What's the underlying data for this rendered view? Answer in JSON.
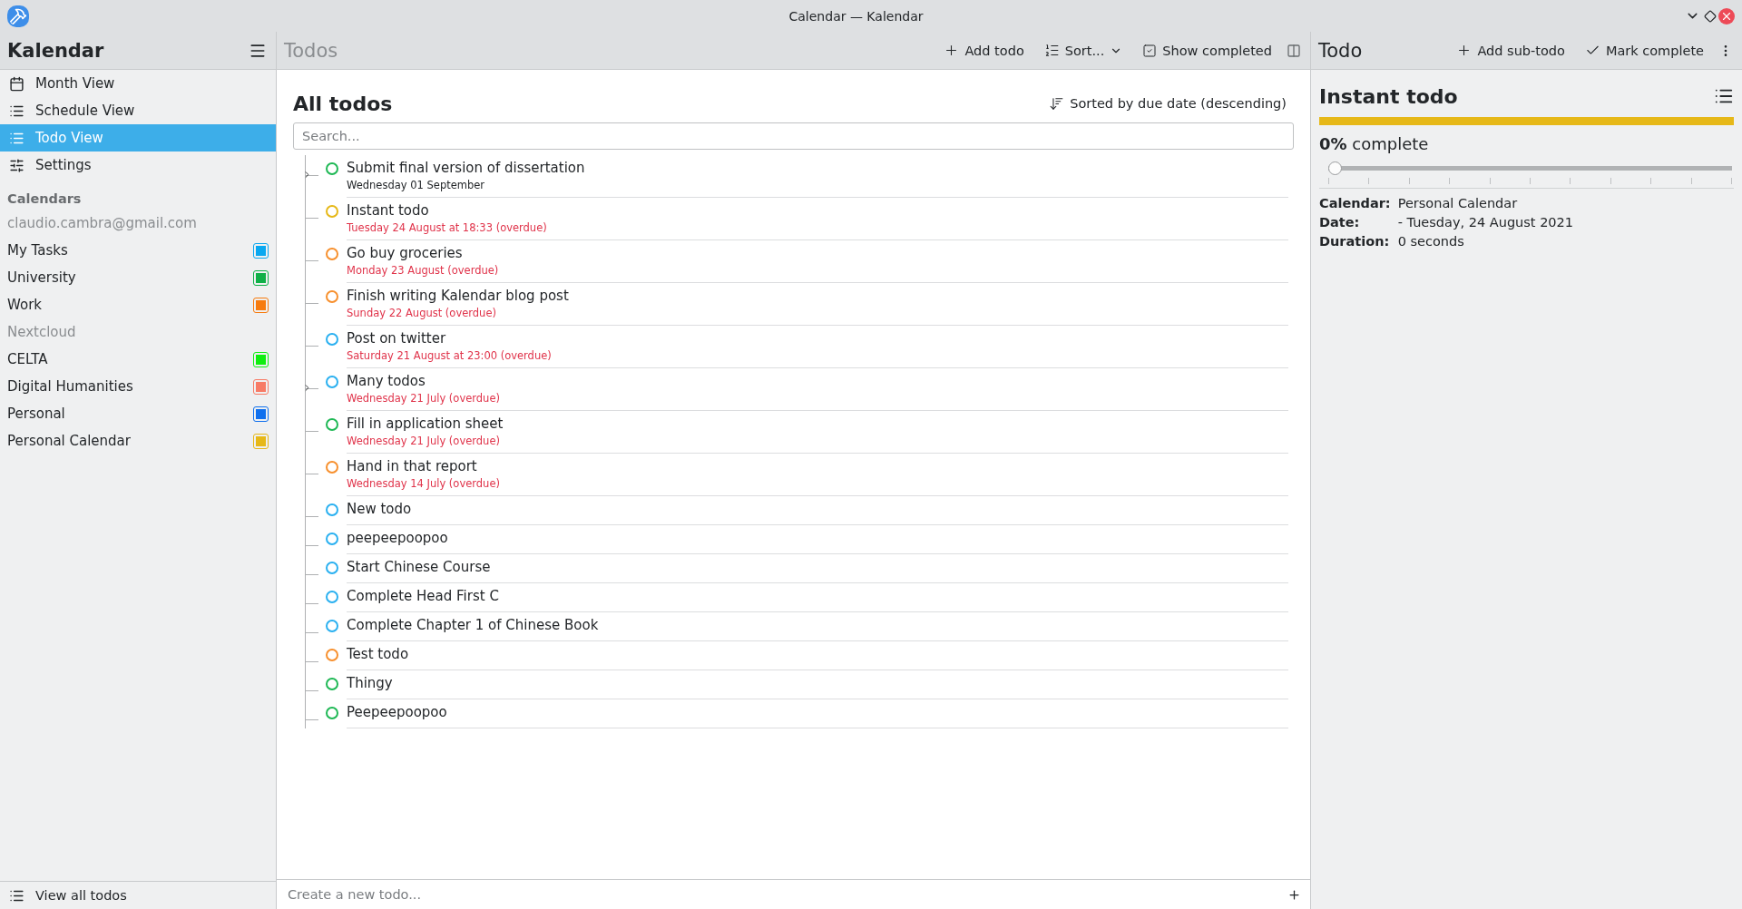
{
  "window": {
    "title": "Calendar — Kalendar"
  },
  "sidebar": {
    "title": "Kalendar",
    "nav": [
      {
        "label": "Month View",
        "selected": false
      },
      {
        "label": "Schedule View",
        "selected": false
      },
      {
        "label": "Todo View",
        "selected": true
      },
      {
        "label": "Settings",
        "selected": false
      }
    ],
    "calendars_heading": "Calendars",
    "calendars": [
      {
        "kind": "account",
        "label": "claudio.cambra@gmail.com"
      },
      {
        "kind": "calendar",
        "label": "My Tasks",
        "color": "#0aa8f0"
      },
      {
        "kind": "calendar",
        "label": "University",
        "color": "#10b048"
      },
      {
        "kind": "calendar",
        "label": "Work",
        "color": "#f77b0e"
      },
      {
        "kind": "account",
        "label": "Nextcloud"
      },
      {
        "kind": "calendar",
        "label": "CELTA",
        "color": "#10ee10"
      },
      {
        "kind": "calendar",
        "label": "Digital Humanities",
        "color": "#f77b66"
      },
      {
        "kind": "calendar",
        "label": "Personal",
        "color": "#1070ee"
      },
      {
        "kind": "calendar",
        "label": "Personal Calendar",
        "color": "#e6b818"
      }
    ],
    "footer": "View all todos"
  },
  "todos": {
    "title": "Todos",
    "actions": [
      {
        "label": "Add todo",
        "dropdown": false
      },
      {
        "label": "Sort...",
        "dropdown": true
      },
      {
        "label": "Show completed",
        "dropdown": false
      }
    ],
    "heading": "All todos",
    "sort_label": "Sorted by due date (descending)",
    "search": {
      "placeholder": "Search..."
    },
    "items": [
      {
        "title": "Submit final version of dissertation",
        "date": "Wednesday 01 September",
        "overdue": false,
        "color": "#1fb855",
        "children_hidden": true
      },
      {
        "title": "Instant todo",
        "date": "Tuesday 24 August at 18:33 (overdue)",
        "overdue": true,
        "color": "#e6b818",
        "children_hidden": false
      },
      {
        "title": "Go buy groceries",
        "date": "Monday 23 August (overdue)",
        "overdue": true,
        "color": "#f7902e",
        "children_hidden": false
      },
      {
        "title": "Finish writing Kalendar blog post",
        "date": "Sunday 22 August (overdue)",
        "overdue": true,
        "color": "#f7902e",
        "children_hidden": false
      },
      {
        "title": "Post on twitter",
        "date": "Saturday 21 August at 23:00 (overdue)",
        "overdue": true,
        "color": "#2ab0f0",
        "children_hidden": false
      },
      {
        "title": "Many todos",
        "date": "Wednesday 21 July (overdue)",
        "overdue": true,
        "color": "#2ab0f0",
        "children_hidden": true
      },
      {
        "title": "Fill in application sheet",
        "date": "Wednesday 21 July (overdue)",
        "overdue": true,
        "color": "#1fb855",
        "children_hidden": false
      },
      {
        "title": "Hand in that report",
        "date": "Wednesday 14 July (overdue)",
        "overdue": true,
        "color": "#f7902e",
        "children_hidden": false
      },
      {
        "title": "New todo",
        "color": "#2ab0f0",
        "children_hidden": false
      },
      {
        "title": "peepeepoopoo",
        "color": "#2ab0f0",
        "children_hidden": false
      },
      {
        "title": "Start Chinese Course",
        "color": "#2ab0f0",
        "children_hidden": false
      },
      {
        "title": "Complete Head First C",
        "color": "#2ab0f0",
        "children_hidden": false
      },
      {
        "title": "Complete Chapter 1 of Chinese Book",
        "color": "#2ab0f0",
        "children_hidden": false
      },
      {
        "title": "Test todo",
        "color": "#f7902e",
        "children_hidden": false
      },
      {
        "title": "Thingy",
        "color": "#1fb855",
        "children_hidden": false
      },
      {
        "title": "Peepeepoopoo",
        "color": "#1fb855",
        "children_hidden": false
      }
    ],
    "new_todo": {
      "placeholder": "Create a new todo..."
    }
  },
  "detail": {
    "title": "Todo",
    "actions": [
      {
        "label": "Add sub-todo"
      },
      {
        "label": "Mark complete"
      }
    ],
    "todo_title": "Instant todo",
    "color": "#e6b818",
    "percent": "0%",
    "percent_label": "complete",
    "progress": {
      "level": 0
    },
    "fields": [
      {
        "label": "Calendar:",
        "value": "Personal Calendar"
      },
      {
        "label": "Date:",
        "value": "- Tuesday, 24 August 2021"
      },
      {
        "label": "Duration:",
        "value": "0 seconds"
      }
    ]
  }
}
